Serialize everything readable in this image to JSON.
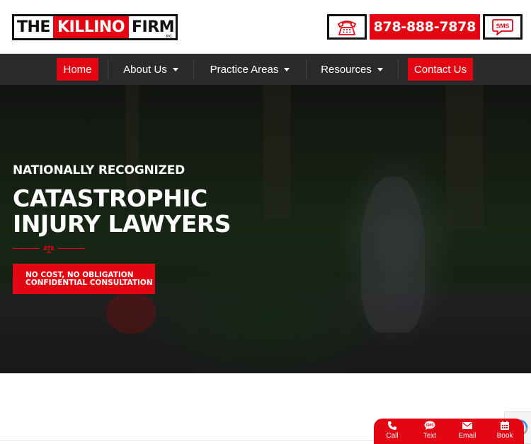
{
  "brand": {
    "logo_the": "THE",
    "logo_killino": "KILLINO",
    "logo_firm": "FIRM",
    "logo_suffix": "P.C."
  },
  "header": {
    "phone_number": "878-888-7878",
    "phone_icon": "telephone-icon",
    "sms_icon": "sms-bubble-icon",
    "sms_label": "SMS"
  },
  "nav": {
    "items": [
      {
        "label": "Home",
        "active": true
      },
      {
        "label": "About Us",
        "has_dropdown": true
      },
      {
        "label": "Practice Areas",
        "has_dropdown": true
      },
      {
        "label": "Resources",
        "has_dropdown": true
      },
      {
        "label": "Contact Us",
        "highlight": true
      }
    ]
  },
  "hero": {
    "eyebrow": "NATIONALLY RECOGNIZED",
    "headline_line1": "CATASTROPHIC",
    "headline_line2": "INJURY LAWYERS",
    "divider_icon": "scales-of-justice-icon",
    "cta_line1": "NO COST, NO OBLIGATION",
    "cta_line2": "CONFIDENTIAL CONSULTATION"
  },
  "contact_widget": {
    "items": [
      {
        "label": "Call",
        "icon": "phone-icon"
      },
      {
        "label": "Text",
        "icon": "sms-icon"
      },
      {
        "label": "Email",
        "icon": "envelope-icon"
      },
      {
        "label": "Book",
        "icon": "calendar-icon"
      }
    ]
  },
  "colors": {
    "brand_red": "#e30613",
    "nav_bg": "#2b2b2b",
    "text_dark": "#111111"
  }
}
